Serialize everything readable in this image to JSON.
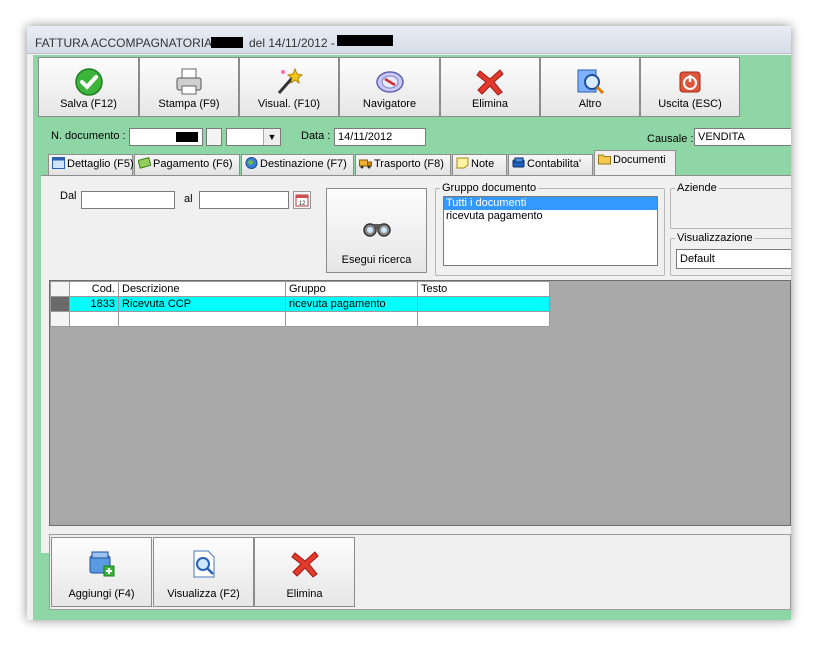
{
  "window": {
    "title_prefix": "FATTURA ACCOMPAGNATORIA",
    "title_mid": "del 14/11/2012 -"
  },
  "toolbar": [
    {
      "label": "Salva (F12)",
      "icon": "check-icon"
    },
    {
      "label": "Stampa (F9)",
      "icon": "printer-icon"
    },
    {
      "label": "Visual. (F10)",
      "icon": "magic-wand-icon"
    },
    {
      "label": "Navigatore",
      "icon": "compass-icon"
    },
    {
      "label": "Elimina",
      "icon": "red-x-icon"
    },
    {
      "label": "Altro",
      "icon": "search-doc-icon"
    },
    {
      "label": "Uscita (ESC)",
      "icon": "power-icon"
    }
  ],
  "header": {
    "doc_label": "N. documento :",
    "date_label": "Data :",
    "date_value": "14/11/2012",
    "causale_label": "Causale :",
    "causale_value": "VENDITA"
  },
  "tabs": [
    {
      "label": "Dettaglio (F5)"
    },
    {
      "label": "Pagamento (F6)"
    },
    {
      "label": "Destinazione (F7)"
    },
    {
      "label": "Trasporto (F8)"
    },
    {
      "label": "Note"
    },
    {
      "label": "Contabilita'"
    },
    {
      "label": "Documenti"
    }
  ],
  "filters": {
    "dal_label": "Dal",
    "al_label": "al",
    "search_button": "Esegui ricerca",
    "gruppo_title": "Gruppo documento",
    "gruppo_items": [
      "Tutti i documenti",
      "ricevuta pagamento"
    ],
    "aziende_title": "Aziende",
    "visual_title": "Visualizzazione",
    "visual_value": "Default"
  },
  "grid": {
    "columns": [
      "Cod.",
      "Descrizione",
      "Gruppo",
      "Testo"
    ],
    "rows": [
      {
        "cod": "1833",
        "descrizione": "Ricevuta CCP",
        "gruppo": "ricevuta pagamento",
        "testo": ""
      }
    ]
  },
  "bottom_buttons": [
    {
      "label": "Aggiungi (F4)",
      "icon": "add-folder-icon"
    },
    {
      "label": "Visualizza (F2)",
      "icon": "view-document-icon"
    },
    {
      "label": "Elimina",
      "icon": "delete-x-icon"
    }
  ]
}
